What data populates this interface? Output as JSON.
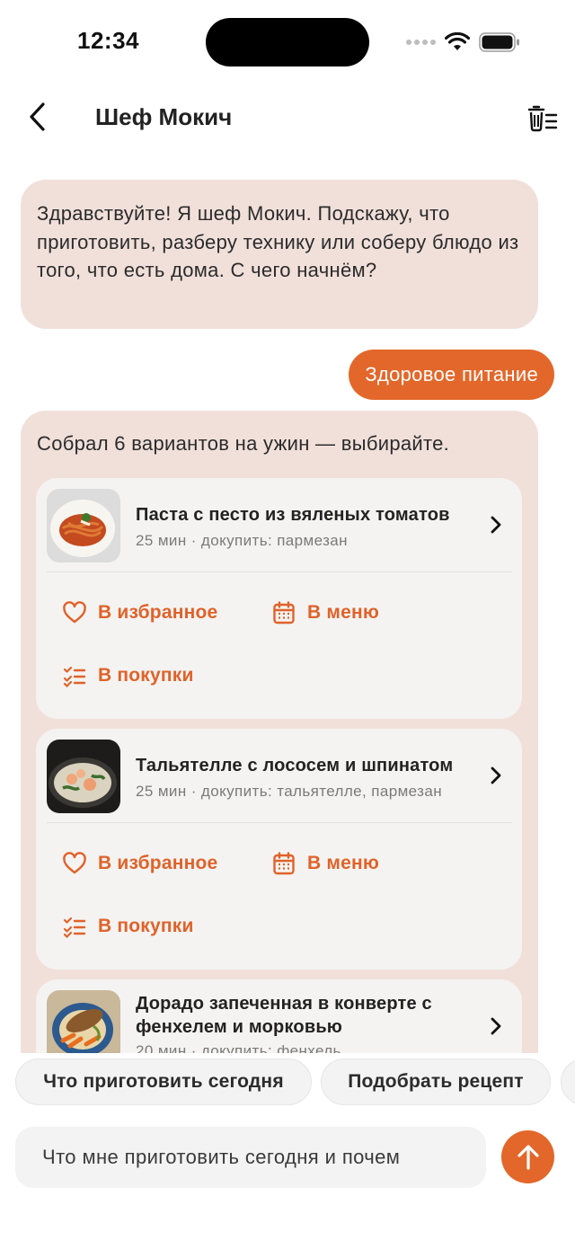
{
  "status_bar": {
    "time": "12:34"
  },
  "header": {
    "title": "Шеф Мокич",
    "back_icon": "chevron-left-icon",
    "clear_icon": "trash-list-icon"
  },
  "chat": {
    "greeting": "Здравствуйте! Я шеф Мокич. Подскажу, что приготовить, разберу технику или соберу блюдо из того, что есть дома. С чего начнём?",
    "user_message": "Здоровое питание",
    "results_intro": "Собрал 6 вариантов на ужин — выбирайте.",
    "recipes": [
      {
        "name": "Паста с песто из вяленых томатов",
        "meta": "25 мин · докупить: пармезан"
      },
      {
        "name": "Тальятелле с лососем и шпинатом",
        "meta": "25 мин · докупить: тальятелле, пармезан"
      },
      {
        "name": "Дорадо запеченная в конверте с фенхелем и морковью",
        "meta": "20 мин · докупить: фенхель"
      }
    ],
    "actions": {
      "favorite": "В избранное",
      "menu": "В меню",
      "shopping": "В покупки"
    }
  },
  "suggestions": [
    "Что приготовить сегодня",
    "Подобрать рецепт",
    ""
  ],
  "input": {
    "value": "Что мне приготовить сегодня и почем"
  },
  "colors": {
    "accent": "#E3672A",
    "bot_bubble": "#F1E0DA",
    "card": "#F4F3F1"
  }
}
